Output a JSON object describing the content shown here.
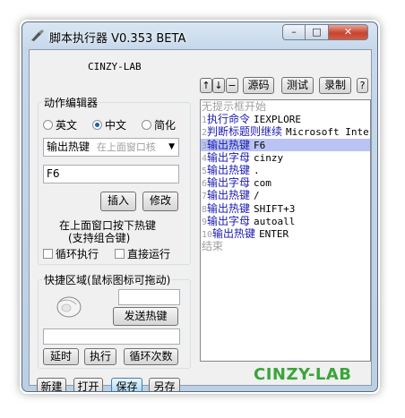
{
  "window": {
    "title": "脚本执行器 V0.353 BETA",
    "minimize": "–",
    "maximize": "□",
    "close": "✕"
  },
  "left": {
    "brand_label": "CINZY-LAB",
    "editor_group": {
      "title": "动作编辑器"
    },
    "language": {
      "options": [
        "英文",
        "中文",
        "简化"
      ],
      "selected": "中文"
    },
    "action_select": {
      "value": "输出热键",
      "hint": "在上面窗口核"
    },
    "param_input": {
      "value": "F6"
    },
    "insert_button": "插入",
    "modify_button": "修改",
    "hint_line1": "在上面窗口按下热键",
    "hint_line2": "(支持组合键)",
    "loop_checkbox": "循环执行",
    "direct_checkbox": "直接运行",
    "quick_group": {
      "title": "快捷区域(鼠标图标可拖动)"
    },
    "send_hotkey_button": "发送热键",
    "delay_button": "延时",
    "execute_button": "执行",
    "loop_count_button": "循环次数",
    "new_button": "新建",
    "open_button": "打开",
    "save_button": "保存",
    "save_as_button": "另存"
  },
  "toolbar": {
    "up_button": "↑",
    "down_button": "↓",
    "minus_button": "−",
    "source_button": "源码",
    "test_button": "测试",
    "record_button": "录制",
    "help_button": "?"
  },
  "editor": {
    "header": "无提示框开始",
    "footer": "结束",
    "highlight_index": 2,
    "lines": [
      {
        "num": "1",
        "cmd": "执行命令",
        "arg": "IEXPLORE"
      },
      {
        "num": "2",
        "cmd": "判断标题则继续",
        "arg": "Microsoft Inter"
      },
      {
        "num": "3",
        "cmd": "输出热键",
        "arg": "F6"
      },
      {
        "num": "4",
        "cmd": "输出字母",
        "arg": "cinzy"
      },
      {
        "num": "5",
        "cmd": "输出热键",
        "arg": "."
      },
      {
        "num": "6",
        "cmd": "输出字母",
        "arg": "com"
      },
      {
        "num": "7",
        "cmd": "输出热键",
        "arg": "/"
      },
      {
        "num": "8",
        "cmd": "输出热键",
        "arg": "SHIFT+3"
      },
      {
        "num": "9",
        "cmd": "输出字母",
        "arg": "autoall"
      },
      {
        "num": "10",
        "cmd": "输出热键",
        "arg": "ENTER"
      }
    ]
  },
  "brand_logo": "CINZY-LAB",
  "colors": {
    "brand_green": "#3aa53a",
    "command_blue": "#1a1ab0",
    "highlight": "#b9c4f4"
  }
}
